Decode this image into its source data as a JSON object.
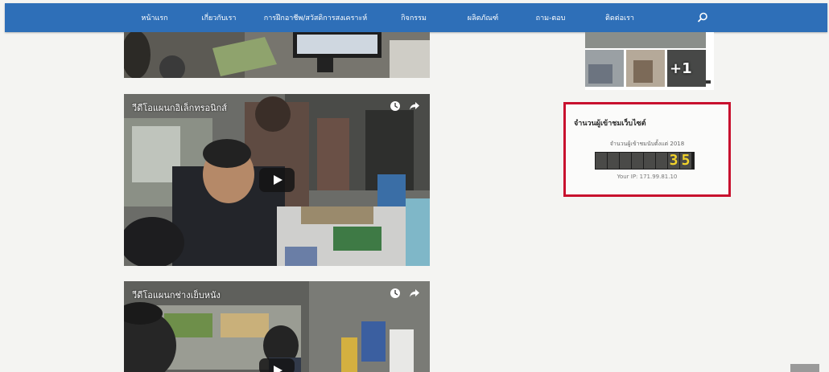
{
  "nav": {
    "items": [
      "หน้าแรก",
      "เกี่ยวกับเรา",
      "การฝึกอาชีพ/สวัสดิการสงเคราะห์",
      "กิจกรรม",
      "ผลิตภัณฑ์",
      "ถาม-ตอบ",
      "ติดต่อเรา"
    ],
    "search_icon": "search-icon",
    "color": "#2e6fb8"
  },
  "videos": [
    {
      "title": ""
    },
    {
      "title": "วีดีโอแผนกอิเล็กทรอนิกส์"
    },
    {
      "title": "วีดีโอแผนกช่างเย็บหนัง"
    }
  ],
  "gallery": {
    "more_label": "+1"
  },
  "counter": {
    "title": "จำนวนผู้เข้าชมเว็บไซต์",
    "subtitle": "จำนวนผู้เข้าชมนับตั้งแต่ 2018",
    "digits": [
      "",
      "",
      "",
      "",
      "",
      "",
      "3",
      "5"
    ],
    "ip": "Your IP: 171.99.81.10",
    "border_color": "#c8102e"
  }
}
